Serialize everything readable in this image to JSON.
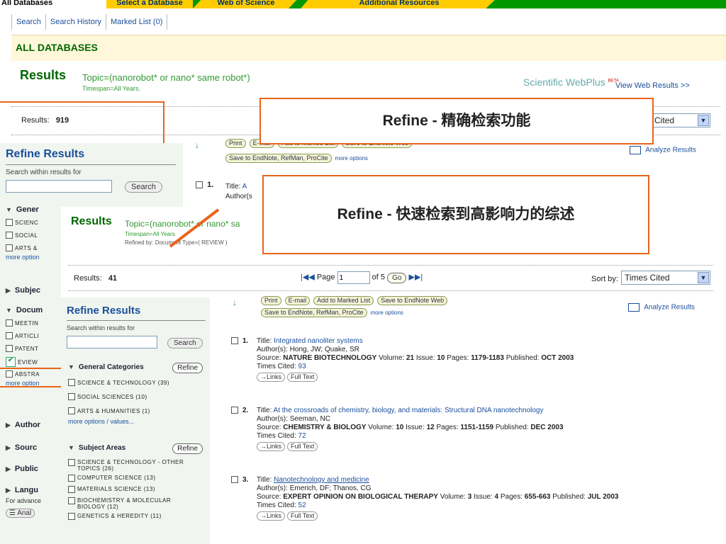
{
  "tabs": [
    "All Databases",
    "Select a Database",
    "Web of Science",
    "Additional Resources"
  ],
  "subnav": [
    "Search",
    "Search History",
    "Marked List (0)"
  ],
  "section_title": "ALL DATABASES",
  "back": {
    "results_title": "Results",
    "query": "Topic=(nanorobot* or nano* same robot*)",
    "timespan": "Timespan=All Years.",
    "webplus_brand": "Scientific WebPlus",
    "webplus_beta": "BETA",
    "webplus_link": "View Web Results >>",
    "results_label": "Results:",
    "results_count": "919",
    "sort_value": "Cited",
    "buttons_row1": [
      "Print",
      "E-mail",
      "Add to Marked List",
      "Save to EndNote Web"
    ],
    "save_btn": "Save to EndNote, RefMan, ProCite",
    "more_options": "more options",
    "analyze": "Analyze Results",
    "refine_title": "Refine Results",
    "search_within": "Search within results for",
    "search_btn": "Search",
    "general_hdr": "Gener",
    "general_items": [
      "SCIENC",
      "SOCIAL",
      "ARTS &"
    ],
    "more_option": "more option",
    "subject_hdr": "Subjec",
    "doctype_hdr": "Docum",
    "doctype_items": [
      "MEETIN",
      "ARTICLI",
      "PATENT",
      "EVIEW",
      "ABSTRA"
    ],
    "author_hdr": "Author",
    "source_hdr": "Sourc",
    "pub_hdr": "Public",
    "lang_hdr": "Langu",
    "advance": "For advance",
    "analyze_btn": "Anal",
    "item1_num": "1.",
    "item1_title_prefix": "Title:",
    "item1_title": "A",
    "item1_author": "Author(s"
  },
  "front": {
    "results_title": "Results",
    "query": "Topic=(nanorobot* or nano* sa",
    "timespan": "Timespan=All Years.",
    "refined_by": "Refined by: Document Type=( REVIEW )",
    "results_label": "Results:",
    "results_count": "41",
    "page_label": "Page",
    "page_value": "1",
    "of_pages": "of 5",
    "go": "Go",
    "sort_label": "Sort by:",
    "sort_value": "Times Cited",
    "buttons_row1": [
      "Print",
      "E-mail",
      "Add to Marked List",
      "Save to EndNote Web"
    ],
    "save_btn": "Save to EndNote, RefMan, ProCite",
    "more_options": "more options",
    "analyze": "Analyze Results",
    "refine_title": "Refine Results",
    "search_within": "Search within results for",
    "search_btn": "Search",
    "general_hdr": "General Categories",
    "refine_btn": "Refine",
    "general_items": [
      "SCIENCE & TECHNOLOGY (39)",
      "SOCIAL SCIENCES (10)",
      "ARTS & HUMANITIES (1)"
    ],
    "more_values": "more options / values...",
    "subject_hdr": "Subject Areas",
    "subject_items": [
      "SCIENCE & TECHNOLOGY - OTHER TOPICS (26)",
      "COMPUTER SCIENCE (13)",
      "MATERIALS SCIENCE (13)",
      "BIOCHEMISTRY & MOLECULAR BIOLOGY (12)",
      "GENETICS & HEREDITY (11)"
    ],
    "records": [
      {
        "num": "1.",
        "title": "Integrated nanoliter systems",
        "authors": "Hong, JW; Quake, SR",
        "journal": "NATURE BIOTECHNOLOGY",
        "volume": "21",
        "issue": "10",
        "pages": "1179-1183",
        "published": "OCT 2003",
        "cited": "93"
      },
      {
        "num": "2.",
        "title": "At the crossroads of chemistry, biology, and materials: Structural DNA nanotechnology",
        "authors": "Seeman, NC",
        "journal": "CHEMISTRY & BIOLOGY",
        "volume": "10",
        "issue": "12",
        "pages": "1151-1159",
        "published": "DEC 2003",
        "cited": "72"
      },
      {
        "num": "3.",
        "title": "Nanotechnology and medicine",
        "authors": "Emerich, DF; Thanos, CG",
        "journal": "EXPERT OPINION ON BIOLOGICAL THERAPY",
        "volume": "3",
        "issue": "4",
        "pages": "655-663",
        "published": "JUL 2003",
        "cited": "52"
      }
    ],
    "labels": {
      "title": "Title:",
      "authors": "Author(s):",
      "source": "Source:",
      "volume": "Volume:",
      "issue": "Issue:",
      "pages": "Pages:",
      "published": "Published:",
      "cited": "Times Cited:",
      "links": "Links",
      "fulltext": "Full Text"
    }
  },
  "callouts": [
    "Refine - 精确检索功能",
    "Refine - 快速检索到高影响力的综述"
  ],
  "colors": {
    "accent_orange": "#e8641b",
    "wos_green": "#006600",
    "tab_yellow": "#ffcc00",
    "tab_green": "#009900"
  }
}
